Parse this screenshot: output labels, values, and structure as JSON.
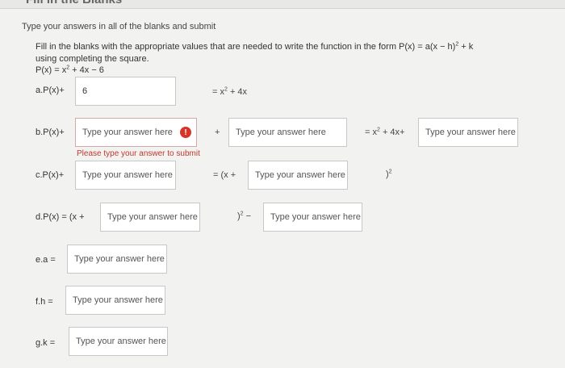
{
  "header": {
    "title": "Fill in the Blanks"
  },
  "instructions": "Type your answers in all of the blanks and submit",
  "prompt": {
    "line1": "Fill in the blanks with the appropriate values that are needed to write the function in the form P(x) = a(x − h)",
    "line1_sup": "2",
    "line1_end": " + k",
    "line2": "using completing the square."
  },
  "function": {
    "text": "P(x) = x",
    "sup": "2",
    "rest": " + 4x − 6"
  },
  "rows": {
    "a": {
      "label": "a.P(x)+",
      "value": "6",
      "after": "= x",
      "after_sup": "2",
      "after_rest": " + 4x"
    },
    "b": {
      "label": "b.P(x)+",
      "plus": "+",
      "mid": "= x",
      "mid_sup": "2",
      "mid_rest": " + 4x+",
      "error": "Please type your answer to submit",
      "error_icon": "!"
    },
    "c": {
      "label": "c.P(x)+",
      "mid": "= (x +",
      "end": ")",
      "end_sup": "2"
    },
    "d": {
      "label": "d.P(x) = (x +",
      "mid": ")",
      "mid_sup": "2",
      "mid_rest": " −"
    },
    "e": {
      "label": "e.a ="
    },
    "f": {
      "label": "f.h ="
    },
    "g": {
      "label": "g.k ="
    }
  },
  "placeholder": "Type your answer here"
}
